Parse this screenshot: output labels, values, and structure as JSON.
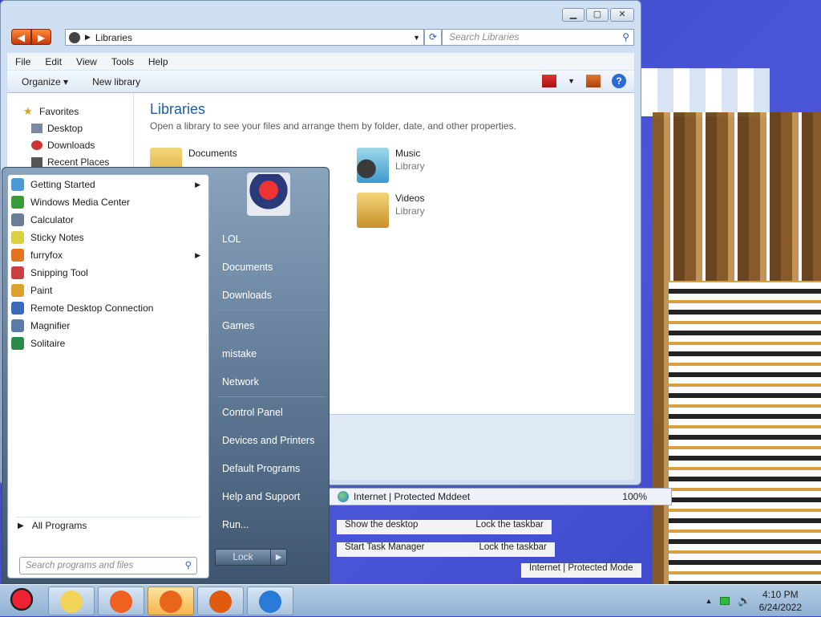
{
  "explorer": {
    "address": "Libraries",
    "search_placeholder": "Search Libraries",
    "menu": [
      "File",
      "Edit",
      "View",
      "Tools",
      "Help"
    ],
    "toolbar": {
      "organize": "Organize",
      "new_library": "New library"
    },
    "nav": [
      {
        "label": "Favorites"
      },
      {
        "label": "Desktop"
      },
      {
        "label": "Downloads"
      },
      {
        "label": "Recent Places"
      }
    ],
    "title": "Libraries",
    "description": "Open a library to see your files and arrange them by folder, date, and other properties.",
    "libraries": [
      {
        "name": "Documents",
        "type": ""
      },
      {
        "name": "Music",
        "type": "Library"
      },
      {
        "name": "Videos",
        "type": "Library"
      }
    ]
  },
  "ghost": {
    "ie_status": "Internet | Protected Mddeet",
    "zoom": "100%",
    "row1": [
      "Show the desktop",
      "Lock the taskbar"
    ],
    "row2": [
      "Start Task Manager",
      "Lock the taskbar"
    ],
    "row3": [
      "Internet | Protected Mode"
    ]
  },
  "start_menu": {
    "programs": [
      {
        "label": "Getting Started",
        "submenu": true,
        "color": "#4a9ad8"
      },
      {
        "label": "Windows Media Center",
        "submenu": false,
        "color": "#3a9a3a"
      },
      {
        "label": "Calculator",
        "submenu": false,
        "color": "#6a7f95"
      },
      {
        "label": "Sticky Notes",
        "submenu": false,
        "color": "#d8d040"
      },
      {
        "label": "furryfox",
        "submenu": true,
        "color": "#e2731f"
      },
      {
        "label": "Snipping Tool",
        "submenu": false,
        "color": "#c84040"
      },
      {
        "label": "Paint",
        "submenu": false,
        "color": "#e0a030"
      },
      {
        "label": "Remote Desktop Connection",
        "submenu": false,
        "color": "#3a6ab8"
      },
      {
        "label": "Magnifier",
        "submenu": false,
        "color": "#5a7aa8"
      },
      {
        "label": "Solitaire",
        "submenu": false,
        "color": "#2a8a4a"
      }
    ],
    "all_programs": "All Programs",
    "search_placeholder": "Search programs and files",
    "right_links": [
      [
        "LOL",
        "Documents",
        "Downloads"
      ],
      [
        "Games",
        "mistake",
        "Network"
      ],
      [
        "Control Panel",
        "Devices and Printers",
        "Default Programs",
        "Help and Support",
        "Run..."
      ]
    ],
    "lock_label": "Lock"
  },
  "taskbar": {
    "buttons": [
      {
        "name": "folder",
        "color": "#f2d458",
        "active": false
      },
      {
        "name": "flash-app",
        "color": "#f06020",
        "active": false
      },
      {
        "name": "firefox",
        "color": "#e8661c",
        "active": true
      },
      {
        "name": "java",
        "color": "#e05a10",
        "active": false
      },
      {
        "name": "internet-explorer",
        "color": "#2a7ad8",
        "active": false
      }
    ],
    "time": "4:10 PM",
    "date": "6/24/2022"
  }
}
